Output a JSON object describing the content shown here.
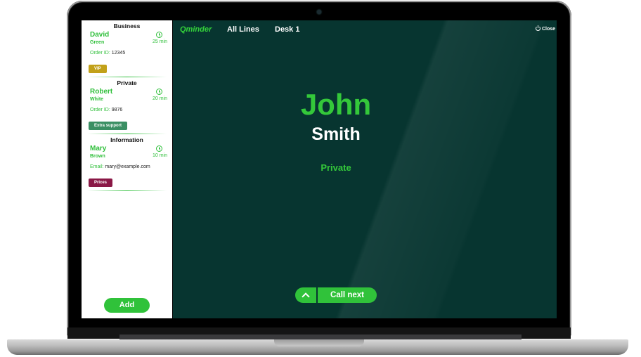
{
  "app": {
    "logo": "Qminder",
    "nav": [
      "All Lines",
      "Desk 1"
    ],
    "close_label": "Close"
  },
  "sidebar": {
    "groups": [
      {
        "title": "Business",
        "first_name": "David",
        "last_name": "Green",
        "wait": "25 min",
        "field_label": "Order ID:",
        "field_value": "12345",
        "tag": "VIP",
        "tag_color": "#c2a119"
      },
      {
        "title": "Private",
        "first_name": "Robert",
        "last_name": "White",
        "wait": "20 min",
        "field_label": "Order ID:",
        "field_value": "9876",
        "tag": "Extra support",
        "tag_color": "#3a8f63"
      },
      {
        "title": "Information",
        "first_name": "Mary",
        "last_name": "Brown",
        "wait": "10 min",
        "field_label": "Email:",
        "field_value": "mary@example.com",
        "tag": "Prices",
        "tag_color": "#8a1846"
      }
    ],
    "add_label": "Add"
  },
  "current": {
    "first_name": "John",
    "last_name": "Smith",
    "service": "Private"
  },
  "actions": {
    "call_next_label": "Call next"
  },
  "colors": {
    "accent": "#30c23a",
    "background": "#073530"
  }
}
